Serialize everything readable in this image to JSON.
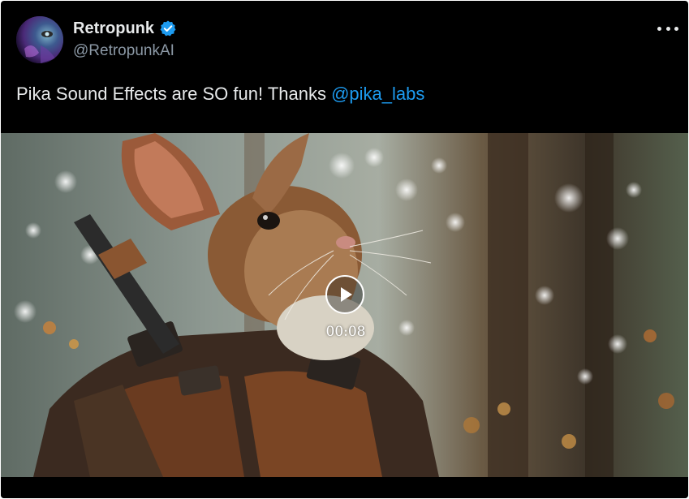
{
  "author": {
    "display_name": "Retropunk",
    "handle": "@RetropunkAI",
    "verified": true,
    "avatar_icon": "avatar-image"
  },
  "tweet": {
    "text": "Pika Sound Effects are SO fun! Thanks ",
    "mention": "@pika_labs"
  },
  "media": {
    "type": "video",
    "duration": "00:08",
    "play_icon": "play-icon"
  },
  "menu": {
    "icon": "more-options-icon"
  },
  "colors": {
    "background": "#000000",
    "text": "#e7e9ea",
    "secondary_text": "#8b98a5",
    "link": "#1d9bf0",
    "verified_badge": "#1d9bf0"
  }
}
